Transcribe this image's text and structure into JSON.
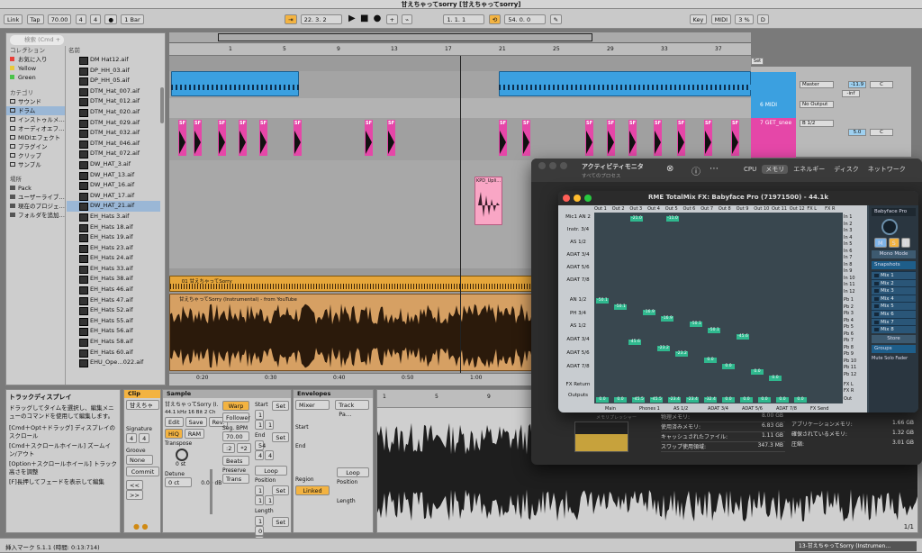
{
  "window": {
    "title": "甘えちゃってsorry  [甘えちゃってsorry]"
  },
  "transport": {
    "link": "Link",
    "tap": "Tap",
    "tempo": "70.00",
    "sig_num": "4",
    "sig_den": "4",
    "metro": "●",
    "quant": "1 Bar",
    "pos": "22.  3.  2",
    "loop_start": "1.  1.  1",
    "loop_len": "54.  0.  0",
    "key": "Key",
    "midi": "MIDI",
    "cpu": "3 %",
    "d": "D"
  },
  "browser": {
    "search_placeholder": "検索 (Cmd + F)",
    "collections_header": "コレクション",
    "collections": [
      {
        "label": "お気に入り",
        "color": "#e8403a"
      },
      {
        "label": "Yellow",
        "color": "#e8c93a"
      },
      {
        "label": "Green",
        "color": "#4ac24a"
      }
    ],
    "categories_header": "カテゴリ",
    "categories": [
      {
        "label": "サウンド",
        "icon": "note-icon"
      },
      {
        "label": "ドラム",
        "icon": "drum-icon"
      },
      {
        "label": "インストゥルメ…",
        "icon": "keys-icon"
      },
      {
        "label": "オーディオエフ…",
        "icon": "fx-icon"
      },
      {
        "label": "MIDIエフェクト",
        "icon": "midi-icon"
      },
      {
        "label": "プラグイン",
        "icon": "plug-icon"
      },
      {
        "label": "クリップ",
        "icon": "clip-icon"
      },
      {
        "label": "サンプル",
        "icon": "wave-icon"
      }
    ],
    "places_header": "場所",
    "places": [
      {
        "label": "Pack"
      },
      {
        "label": "ユーザーライブ…"
      },
      {
        "label": "現在のプロジェ…"
      },
      {
        "label": "フォルダを追加…"
      }
    ],
    "name_header": "名前",
    "files": [
      "DM Hat12.aif",
      "DP_HH_03.aif",
      "DP_HH_05.aif",
      "DTM_Hat_007.aif",
      "DTM_Hat_012.aif",
      "DTM_Hat_020.aif",
      "DTM_Hat_029.aif",
      "DTM_Hat_032.aif",
      "DTM_Hat_046.aif",
      "DTM_Hat_072.aif",
      "DW_HAT_3.aif",
      "DW_HAT_13.aif",
      "DW_HAT_16.aif",
      "DW_HAT_17.aif",
      "DW_HAT_21.aif",
      "EH_Hats 3.aif",
      "EH_Hats 18.aif",
      "EH_Hats 19.aif",
      "EH_Hats 23.aif",
      "EH_Hats 24.aif",
      "EH_Hats 33.aif",
      "EH_Hats 38.aif",
      "EH_Hats 46.aif",
      "EH_Hats 47.aif",
      "EH_Hats 52.aif",
      "EH_Hats 55.aif",
      "EH_Hats 56.aif",
      "EH_Hats 58.aif",
      "EH_Hats 60.aif",
      "EHU_Ope…022.aif"
    ],
    "selected_file_index": 14
  },
  "arrangement": {
    "ruler": [
      "1",
      "5",
      "9",
      "13",
      "17",
      "21",
      "25",
      "29",
      "33",
      "37"
    ],
    "time_ruler": [
      "0:20",
      "0:30",
      "0:40",
      "0:50",
      "1:00",
      "1:10",
      "1:20"
    ],
    "tracks": [
      {
        "name": "6 MIDI",
        "output": "No Output"
      },
      {
        "name": "7 GET_snee",
        "input": "B 1/2",
        "output": "Master",
        "vol": "5.0",
        "pan": "C"
      }
    ],
    "master_vol": "-11.9",
    "master_pan": "C",
    "inf": "-inf",
    "set_label": "Set",
    "sf_label": "SF",
    "kpd_label": "KPD_Upli…",
    "audio1_label": "_01 甘えちゃってSorry",
    "audio2_label": "甘えちゃってSorry (Instrumental) - from YouTube"
  },
  "info_view": {
    "title": "トラックディスプレイ",
    "body": "ドラッグしてタイムを選択し、編集メニューのコマンドを使用して編集します。",
    "tips": [
      "[Cmd＋Opt＋ドラッグ] ディスプレイのスクロール",
      "[Cmd＋スクロールホイール] ズームイン/アウト",
      "[Option＋スクロールホイール] トラック高さを調整",
      "[F]長押してフェードを表示して編集"
    ]
  },
  "clip_view": {
    "clip_header": "Clip",
    "clip_name": "甘えちゃってS…",
    "sig_label": "Signature",
    "sig_num": "4",
    "sig_den": "4",
    "groove_label": "Groove",
    "groove_val": "None",
    "commit": "Commit",
    "sample_header": "Sample",
    "sample_name": "甘えちゃってSorry (I…",
    "sample_info": "44.1 kHz 16 Bit 2 Ch",
    "edit": "Edit",
    "save": "Save",
    "rev": "Rev.",
    "hiq": "HiQ",
    "ram": "RAM",
    "transpose_label": "Transpose",
    "transpose_val": "0 st",
    "detune_label": "Detune",
    "detune_val": "0 ct",
    "gain_val": "0.00 dB",
    "warp": "Warp",
    "follower": "Follower",
    "seg_bpm_label": "Seg. BPM",
    "seg_bpm": "70.00",
    "half": ":2",
    "dbl": "*2",
    "warp_mode": "Beats",
    "preserve_label": "Preserve",
    "preserve_val": "Trans",
    "start_label": "Start",
    "end_label": "End",
    "set": "Set",
    "loop": "Loop",
    "position_label": "Position",
    "length_label": "Length",
    "start_vals": [
      "1",
      "1",
      "1"
    ],
    "end_vals": [
      "54",
      "4",
      "4"
    ],
    "pos_vals": [
      "1",
      "1",
      "1"
    ],
    "len_vals": [
      "1",
      "0",
      "0"
    ],
    "env_header": "Envelopes",
    "env_device": "Mixer",
    "env_param": "Track Pa…",
    "region_label": "Region",
    "linked": "Linked"
  },
  "sample_editor": {
    "ruler": [
      "1",
      "5",
      "9",
      "13",
      "17",
      "21",
      "25",
      "29",
      "33",
      "37",
      "41"
    ],
    "page": "1/1"
  },
  "status": {
    "left": "挿入マーク 5.1.1 (時間: 0:13:714)",
    "right": "13-甘えちゃってSorry (Instrumen…"
  },
  "activity_monitor": {
    "title": "アクティビティモニタ",
    "subtitle": "すべてのプロセス",
    "tabs": [
      "CPU",
      "メモリ",
      "エネルギー",
      "ディスク",
      "ネットワーク"
    ],
    "active_tab": "メモリ",
    "memory_rows": [
      {
        "label": "物理メモリ:",
        "value": "8.00 GB"
      },
      {
        "label": "使用済みメモリ:",
        "value": "6.83 GB"
      },
      {
        "label": "キャッシュされたファイル:",
        "value": "1.11 GB"
      },
      {
        "label": "スワップ使用領域:",
        "value": "347.3 MB"
      }
    ],
    "right_rows": [
      {
        "label": "アプリケーションメモリ:",
        "value": "1.66 GB"
      },
      {
        "label": "確保されているメモリ:",
        "value": "1.32 GB"
      },
      {
        "label": "圧縮:",
        "value": "3.01 GB"
      }
    ],
    "hw_label": "HARDWARE OUTPUTS",
    "pressure_label": "メモリプレッシャー"
  },
  "totalmix": {
    "title": "RME TotalMix FX: Babyface Pro (71971500) - 44.1k",
    "out_cols": [
      "Out 1",
      "Out 2",
      "Out 3",
      "Out 4",
      "Out 5",
      "Out 6",
      "Out 7",
      "Out 8",
      "Out 9",
      "Out 10",
      "Out 11",
      "Out 12",
      "FX L",
      "FX R"
    ],
    "in_rows": [
      "Mic1 AN 2",
      "Instr. 3/4",
      "AS 1/2",
      "ADAT 3/4",
      "ADAT 5/6",
      "ADAT 7/8"
    ],
    "pb_rows": [
      "AN 1/2",
      "PH 3/4",
      "AS 1/2",
      "ADAT 3/4",
      "ADAT 5/6",
      "ADAT 7/8"
    ],
    "fx_return": "FX Return",
    "outputs": "Outputs",
    "in_labels": [
      "In 1",
      "In 2",
      "In 3",
      "In 4",
      "In 5",
      "In 6",
      "In 7",
      "In 8",
      "In 9",
      "In 10",
      "In 11",
      "In 12"
    ],
    "pb_labels": [
      "Pb 1",
      "Pb 2",
      "Pb 3",
      "Pb 4",
      "Pb 5",
      "Pb 6",
      "Pb 7",
      "Pb 8",
      "Pb 9",
      "Pb 10",
      "Pb 11",
      "Pb 12"
    ],
    "fx_labels": [
      "FX L",
      "FX R"
    ],
    "out_label": "Out",
    "bottom_labels": [
      "Main",
      "Phones 1",
      "AS 1/2",
      "ADAT 3/4",
      "ADAT 5/6",
      "ADAT 7/8",
      "FX Send"
    ],
    "input_vals": [
      "-21.0",
      "-11.0"
    ],
    "pb_vals": [
      "-50.1",
      "-50.1",
      "-16.9",
      "-16.9",
      "-50.1",
      "-50.1",
      "-45.6",
      "-45.6",
      "-23.2",
      "-23.2",
      "0.0",
      "0.0",
      "0.0",
      "0.0"
    ],
    "out_vals": [
      "0.0",
      "0.0",
      "-45.5",
      "-45.5",
      "-23.4",
      "-23.4",
      "-32.4",
      "0.0",
      "0.0",
      "0.0",
      "0.0",
      "0.0"
    ],
    "device": "Babyface Pro",
    "mono": "Mono Mode",
    "snapshots": "Snapshots",
    "mixes": [
      "Mix 1",
      "Mix 2",
      "Mix 3",
      "Mix 4",
      "Mix 5",
      "Mix 6",
      "Mix 7",
      "Mix 8"
    ],
    "store": "Store",
    "groups": "Groups",
    "mute": "Mute",
    "solo": "Solo",
    "fader": "Fader"
  }
}
